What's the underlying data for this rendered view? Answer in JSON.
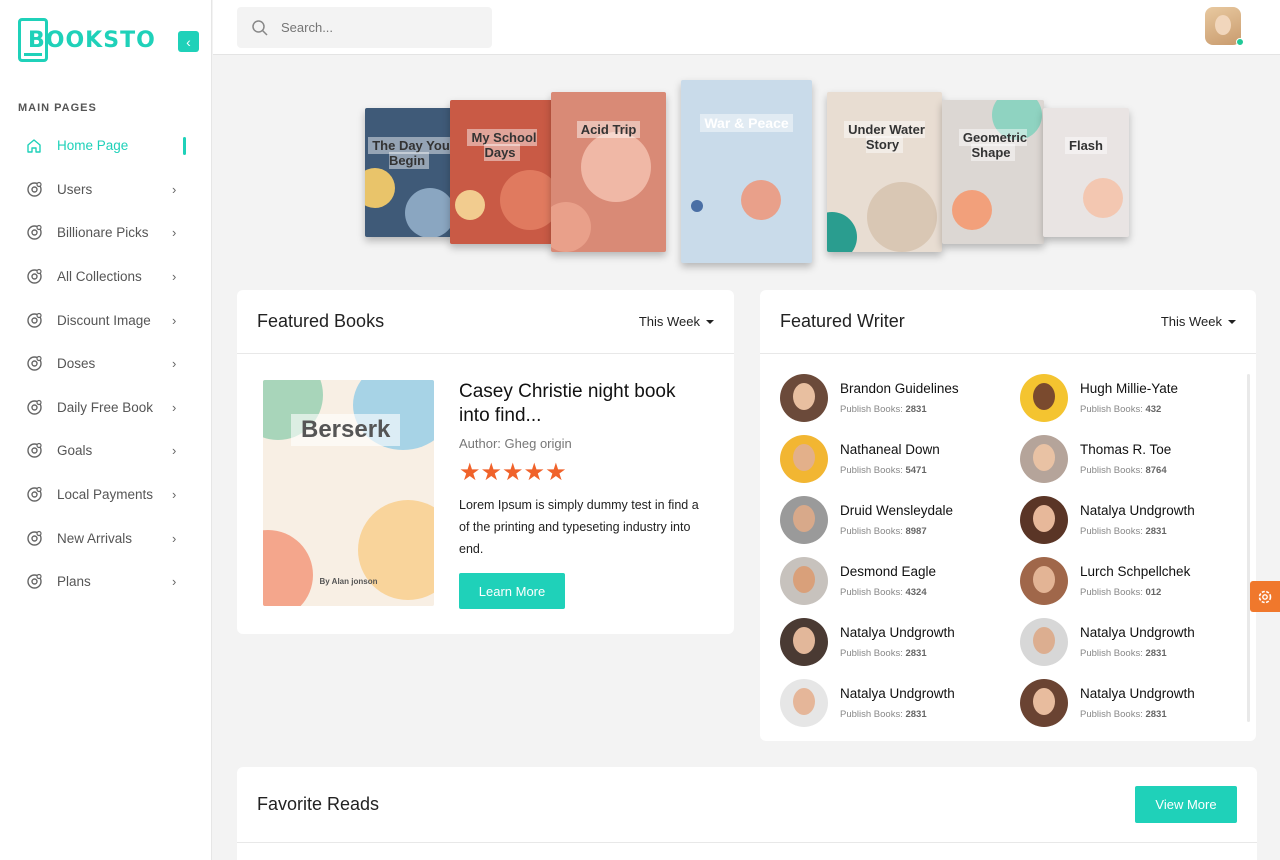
{
  "brand": {
    "name": "BOOKSTO",
    "accent": "#1fd1b9"
  },
  "sidebar": {
    "section_label": "MAIN PAGES",
    "items": [
      {
        "label": "Home Page",
        "icon": "home-icon",
        "active": true
      },
      {
        "label": "Users",
        "icon": "gear-user-icon"
      },
      {
        "label": "Billionare Picks",
        "icon": "gear-user-icon"
      },
      {
        "label": "All Collections",
        "icon": "gear-user-icon"
      },
      {
        "label": "Discount Image",
        "icon": "gear-user-icon"
      },
      {
        "label": "Doses",
        "icon": "gear-user-icon"
      },
      {
        "label": "Daily Free Book",
        "icon": "gear-user-icon"
      },
      {
        "label": "Goals",
        "icon": "gear-user-icon"
      },
      {
        "label": "Local Payments",
        "icon": "gear-user-icon"
      },
      {
        "label": "New Arrivals",
        "icon": "gear-user-icon"
      },
      {
        "label": "Plans",
        "icon": "gear-user-icon"
      }
    ]
  },
  "topbar": {
    "search_placeholder": "Search..."
  },
  "banner_books": [
    {
      "title": "The Day You Begin",
      "color": "#3f5a78"
    },
    {
      "title": "My School Days",
      "color": "#c95a45"
    },
    {
      "title": "Acid Trip",
      "color": "#d98a76"
    },
    {
      "title": "War & Peace",
      "color": "#c9dbea"
    },
    {
      "title": "Under Water Story",
      "color": "#e8ddd2"
    },
    {
      "title": "Geometric Shape",
      "color": "#dcd7d3"
    },
    {
      "title": "Flash",
      "color": "#e9e4e3"
    }
  ],
  "featured_books": {
    "title": "Featured Books",
    "period": "This Week",
    "cover_title": "Berserk",
    "cover_author": "By Alan jonson",
    "book_name": "Casey Christie night book into find...",
    "author": "Author: Gheg origin",
    "rating": 5,
    "stars": "★★★★★",
    "description": "Lorem Ipsum is simply dummy test in find a of the printing and typeseting industry into end.",
    "button": "Learn More"
  },
  "featured_writer": {
    "title": "Featured Writer",
    "period": "This Week",
    "books_label": "Publish Books:",
    "writers": [
      {
        "name": "Brandon Guidelines",
        "books": "2831"
      },
      {
        "name": "Hugh Millie-Yate",
        "books": "432"
      },
      {
        "name": "Nathaneal Down",
        "books": "5471"
      },
      {
        "name": "Thomas R. Toe",
        "books": "8764"
      },
      {
        "name": "Druid Wensleydale",
        "books": "8987"
      },
      {
        "name": "Natalya Undgrowth",
        "books": "2831"
      },
      {
        "name": "Desmond Eagle",
        "books": "4324"
      },
      {
        "name": "Lurch Schpellchek",
        "books": "012"
      },
      {
        "name": "Natalya Undgrowth",
        "books": "2831"
      },
      {
        "name": "Natalya Undgrowth",
        "books": "2831"
      },
      {
        "name": "Natalya Undgrowth",
        "books": "2831"
      },
      {
        "name": "Natalya Undgrowth",
        "books": "2831"
      }
    ]
  },
  "favorite_reads": {
    "title": "Favorite Reads",
    "button": "View More"
  }
}
